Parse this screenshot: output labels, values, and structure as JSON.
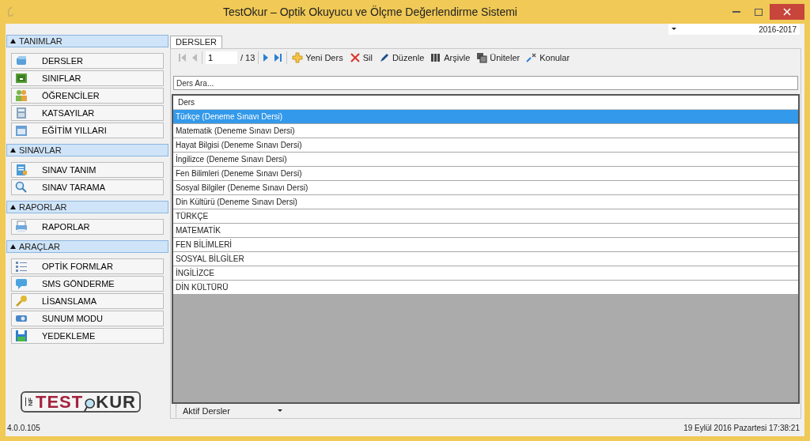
{
  "window": {
    "title": "TestOkur – Optik Okuyucu ve Ölçme Değerlendirme Sistemi"
  },
  "year_selector": {
    "value": "2016-2017"
  },
  "sidebar": {
    "sections": [
      {
        "title": "TANIMLAR",
        "expanded": true,
        "items": [
          {
            "label": "DERSLER"
          },
          {
            "label": "SINIFLAR"
          },
          {
            "label": "ÖĞRENCİLER"
          },
          {
            "label": "KATSAYILAR"
          },
          {
            "label": "EĞİTİM YILLARI"
          }
        ]
      },
      {
        "title": "SINAVLAR",
        "expanded": true,
        "items": [
          {
            "label": "SINAV TANIM"
          },
          {
            "label": "SINAV TARAMA"
          }
        ]
      },
      {
        "title": "RAPORLAR",
        "expanded": true,
        "items": [
          {
            "label": "RAPORLAR"
          }
        ]
      },
      {
        "title": "ARAÇLAR",
        "expanded": true,
        "items": [
          {
            "label": "OPTİK FORMLAR"
          },
          {
            "label": "SMS GÖNDERME"
          },
          {
            "label": "LİSANSLAMA"
          },
          {
            "label": "SUNUM MODU"
          },
          {
            "label": "YEDEKLEME"
          }
        ]
      }
    ]
  },
  "logo": {
    "prefix": "NF",
    "left": "TEST",
    "right": "KUR"
  },
  "tabs": [
    {
      "label": "DERSLER",
      "selected": true
    }
  ],
  "toolbar": {
    "page": "1",
    "page_count": "/ 13",
    "buttons": [
      {
        "label": "Yeni Ders"
      },
      {
        "label": "Sil"
      },
      {
        "label": "Düzenle"
      },
      {
        "label": "Arşivle"
      },
      {
        "label": "Üniteler"
      },
      {
        "label": "Konular"
      }
    ]
  },
  "search": {
    "placeholder": "Ders Ara..."
  },
  "table": {
    "columns": [
      "Ders"
    ],
    "rows": [
      {
        "cells": [
          "Türkçe (Deneme Sınavı Dersi)"
        ],
        "selected": true
      },
      {
        "cells": [
          "Matematik (Deneme Sınavı Dersi)"
        ],
        "selected": false
      },
      {
        "cells": [
          "Hayat Bilgisi (Deneme Sınavı Dersi)"
        ],
        "selected": false
      },
      {
        "cells": [
          "İngilizce (Deneme Sınavı Dersi)"
        ],
        "selected": false
      },
      {
        "cells": [
          "Fen Bilimleri (Deneme Sınavı Dersi)"
        ],
        "selected": false
      },
      {
        "cells": [
          "Sosyal Bilgiler (Deneme Sınavı Dersi)"
        ],
        "selected": false
      },
      {
        "cells": [
          "Din Kültürü (Deneme Sınavı Dersi)"
        ],
        "selected": false
      },
      {
        "cells": [
          "TÜRKÇE"
        ],
        "selected": false
      },
      {
        "cells": [
          "MATEMATİK"
        ],
        "selected": false
      },
      {
        "cells": [
          "FEN BİLİMLERİ"
        ],
        "selected": false
      },
      {
        "cells": [
          "SOSYAL BİLGİLER"
        ],
        "selected": false
      },
      {
        "cells": [
          "İNGİLİZCE"
        ],
        "selected": false
      },
      {
        "cells": [
          "DİN KÜLTÜRÜ"
        ],
        "selected": false
      }
    ]
  },
  "filter": {
    "value": "Aktif Dersler"
  },
  "status_bar": {
    "version": "4.0.0.105",
    "datetime": "19 Eylül 2016 Pazartesi 17:38:21"
  }
}
